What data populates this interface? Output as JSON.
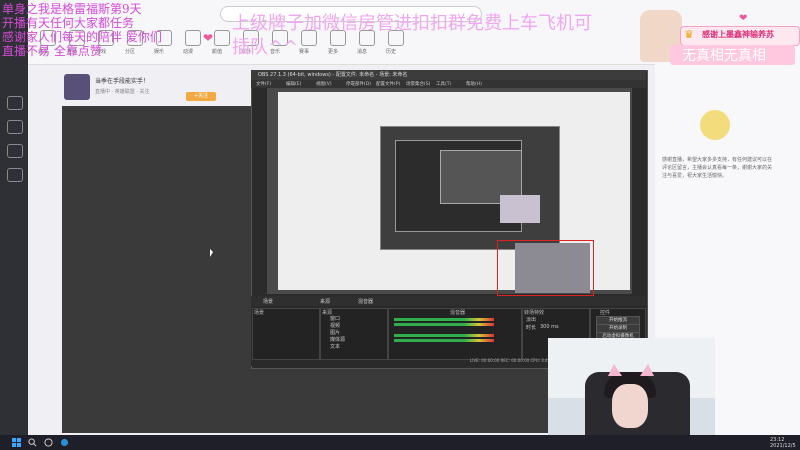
{
  "overlay": {
    "left_lines": [
      "单身之我是格雷福斯第9天",
      "开播有天任何大家都任务",
      "感谢家人们每天的陪伴 爱你们",
      "直播不易 全靠点赞"
    ],
    "main_text": "上级牌子加微信房管进扣扣群免费上车飞机可插队^^",
    "banner_text": "感谢上墨鑫神输养苏",
    "tag_text": "无真相无真相",
    "crown_icon": "crown-icon",
    "heart_icon": "heart-icon"
  },
  "browser": {
    "room_title": "当季在手段能实手！",
    "room_meta": "直播中 · 英雄联盟 · 关注",
    "follow_label": "+关注",
    "nav_labels": [
      "首页",
      "直播",
      "游戏",
      "分区",
      "娱乐",
      "动漫",
      "颜值",
      "户外",
      "音乐",
      "赛事",
      "更多",
      "消息",
      "历史"
    ],
    "chat_text": "感谢直播，希望大家多多支持，有任何建议可以在评论区留言，主播会认真看每一条，谢谢大家的关注与喜爱，祝大家生活愉快。"
  },
  "obs": {
    "title": "OBS 27.1.3 (64-bit, windows) - 配置文件: 未命名 - 场景: 未命名",
    "menu": [
      "文件(F)",
      "编辑(E)",
      "视图(V)",
      "停靠部件(D)",
      "配置文件(P)",
      "场景集合(S)",
      "工具(T)",
      "帮助(H)"
    ],
    "tabs": [
      "场景",
      "来源",
      "混音器",
      "转场特效",
      "控件"
    ],
    "scenes_header": "场景",
    "sources_header": "来源",
    "mixer_header": "混音器",
    "transition_header": "转场特效",
    "controls_header": "控件",
    "sources": [
      "窗口",
      "视频",
      "图片",
      "媒体源",
      "文本"
    ],
    "transition": "淡出",
    "duration_label": "时长",
    "duration_value": "300 ms",
    "controls": [
      "开始推流",
      "开始录制",
      "启动虚拟摄像机",
      "工作室模式",
      "设置",
      "退出"
    ],
    "status": "LIVE: 00:00:00  REC: 00:00:00  CPU: 3.4%, 30.00 fps"
  },
  "taskbar": {
    "time": "23:12",
    "date": "2021/12/5"
  },
  "colors": {
    "overlay_magenta": "#d44bd7",
    "overlay_pink": "#f0a7f0",
    "obs_bg": "#2b2b2b",
    "meter_green": "#2fae4b"
  }
}
